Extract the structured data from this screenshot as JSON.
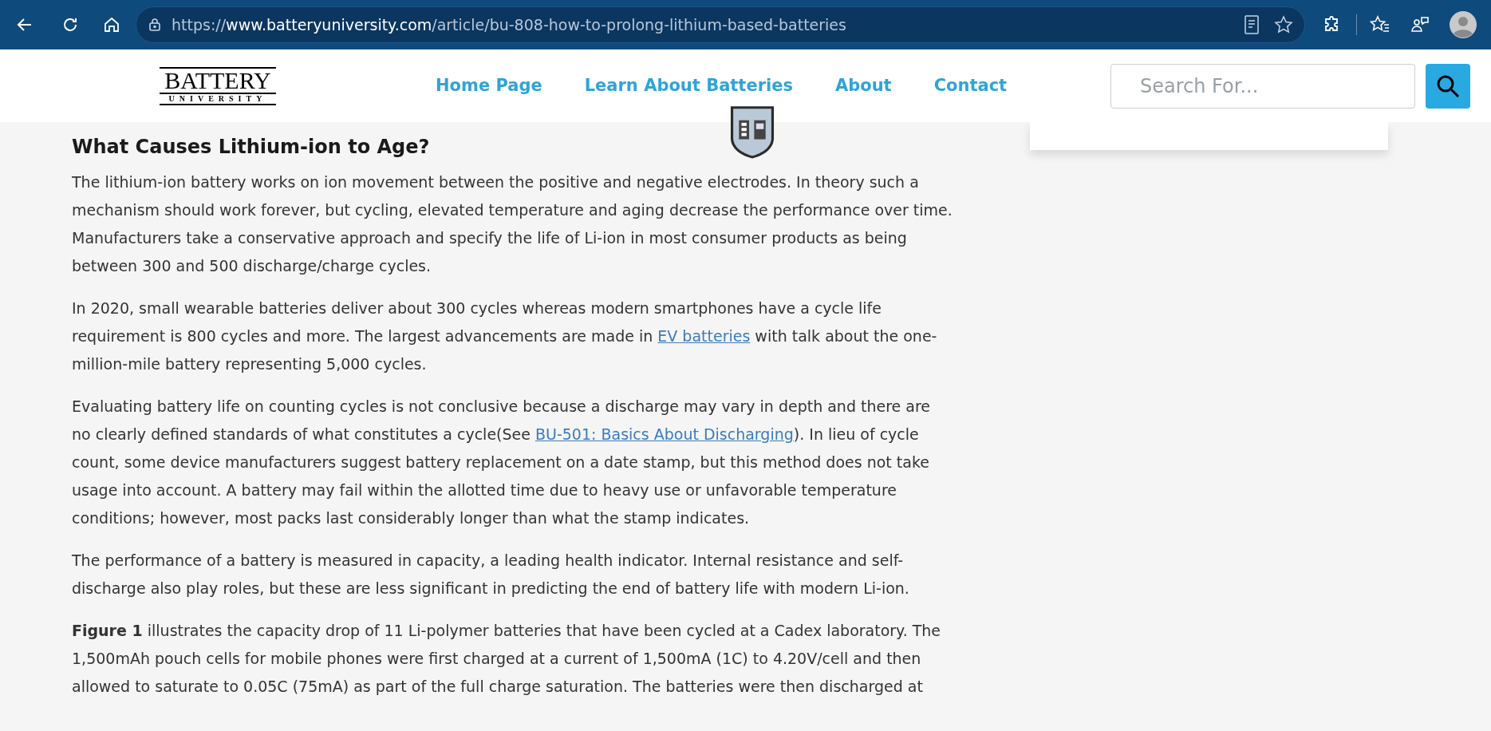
{
  "browser": {
    "url_scheme": "https://",
    "url_host": "www.batteryuniversity.com",
    "url_path": "/article/bu-808-how-to-prolong-lithium-based-batteries"
  },
  "header": {
    "logo_top": "BATTERY",
    "logo_bottom": "UNIVERSITY",
    "nav": [
      "Home Page",
      "Learn About Batteries",
      "About",
      "Contact"
    ],
    "search": {
      "placeholder": "Search For..."
    }
  },
  "article": {
    "heading": "What Causes Lithium-ion to Age?",
    "paragraphs": [
      {
        "parts": [
          {
            "kind": "text",
            "text": "The lithium-ion battery works on ion movement between the positive and negative electrodes. In theory such a mechanism should work forever, but cycling, elevated temperature and aging decrease the performance over time. Manufacturers take a conservative approach and specify the life of Li-ion in most consumer products as being between 300 and 500 discharge/charge cycles."
          }
        ]
      },
      {
        "parts": [
          {
            "kind": "text",
            "text": "In 2020, small wearable batteries deliver about 300 cycles whereas modern smartphones have a cycle life requirement is 800 cycles and more. The largest advancements are made in "
          },
          {
            "kind": "link",
            "text": "EV batteries"
          },
          {
            "kind": "text",
            "text": " with talk about the one-million-mile battery representing 5,000 cycles."
          }
        ]
      },
      {
        "parts": [
          {
            "kind": "text",
            "text": "Evaluating battery life on counting cycles is not conclusive because a discharge may vary in depth and there are no clearly defined standards of what constitutes a cycle(See "
          },
          {
            "kind": "link",
            "text": "BU-501: Basics About Discharging"
          },
          {
            "kind": "text",
            "text": "). In lieu of cycle count, some device manufacturers suggest battery replacement on a date stamp, but this method does not take usage into account. A battery may fail within the allotted time due to heavy use or unfavorable temperature conditions; however, most packs last considerably longer than what the stamp indicates."
          }
        ]
      },
      {
        "parts": [
          {
            "kind": "text",
            "text": "The performance of a battery is measured in capacity, a leading health indicator. Internal resistance and self-discharge also play roles, but these are less significant in predicting the end of battery life with modern Li-ion."
          }
        ]
      },
      {
        "parts": [
          {
            "kind": "text",
            "text": "**Figure 1** illustrates the capacity drop of 11 Li-polymer batteries that have been cycled at a Cadex laboratory. The 1,500mAh pouch cells for mobile phones were first charged at a current of 1,500mA (1C) to 4.20V/cell and then allowed to saturate to 0.05C (75mA) as part of the full charge saturation. The batteries were then discharged at"
          }
        ]
      }
    ]
  }
}
